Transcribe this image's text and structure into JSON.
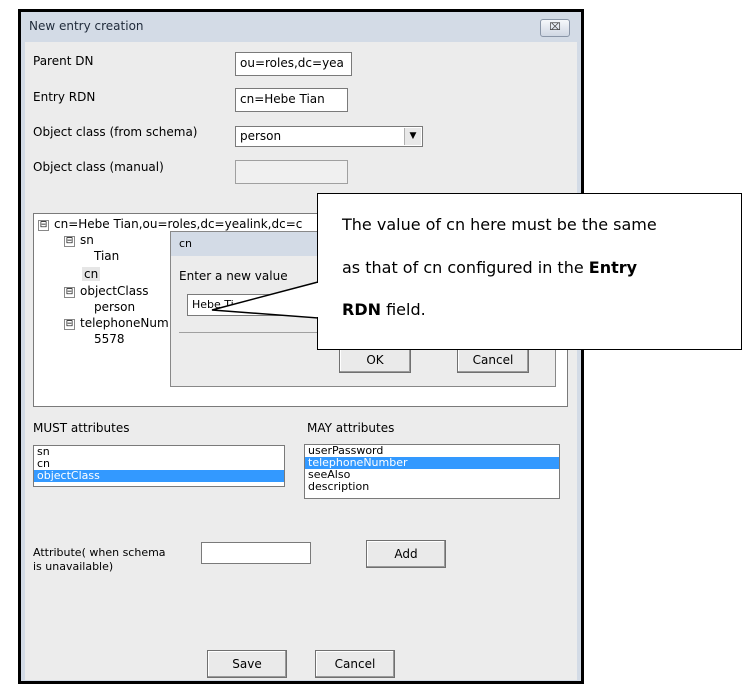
{
  "window": {
    "title": "New entry creation",
    "close_glyph": "⌧"
  },
  "form": {
    "parent_dn_label": "Parent DN",
    "parent_dn_value": "ou=roles,dc=yea",
    "entry_rdn_label": "Entry RDN",
    "entry_rdn_value": "cn=Hebe Tian",
    "object_class_schema_label": "Object class (from schema)",
    "object_class_schema_value": "person",
    "object_class_manual_label": "Object class (manual)",
    "object_class_manual_value": ""
  },
  "tree": {
    "root": "cn=Hebe Tian,ou=roles,dc=yealink,dc=c",
    "nodes": [
      {
        "label": "sn",
        "value": "Tian"
      },
      {
        "label": "cn"
      },
      {
        "label": "objectClass",
        "value": "person"
      },
      {
        "label": "telephoneNum",
        "value": "5578"
      }
    ],
    "expand_glyph": "⊟"
  },
  "dialog": {
    "title": "cn",
    "prompt": "Enter a new value",
    "input_value": "Hebe Ti",
    "ok_label": "OK",
    "cancel_label": "Cancel"
  },
  "must_attributes": {
    "label": "MUST attributes",
    "items": [
      "sn",
      "cn",
      "objectClass"
    ],
    "selected_index": 2
  },
  "may_attributes": {
    "label": "MAY attributes",
    "items": [
      "userPassword",
      "telephoneNumber",
      "seeAlso",
      "description"
    ],
    "selected_index": 1
  },
  "attribute_add": {
    "label_line1": "Attribute( when schema",
    "label_line2": "is unavailable)",
    "value": "",
    "add_label": "Add"
  },
  "footer": {
    "save_label": "Save",
    "cancel_label": "Cancel"
  },
  "callout": {
    "line1": "The value of cn here must be the same",
    "line2_prefix": "as that of cn configured in the ",
    "line2_bold": "Entry",
    "line3_bold": "RDN",
    "line3_suffix": " field."
  },
  "colors": {
    "selection": "#3399ff",
    "titlebar": "#d3dbe6",
    "client_bg": "#ececec"
  }
}
